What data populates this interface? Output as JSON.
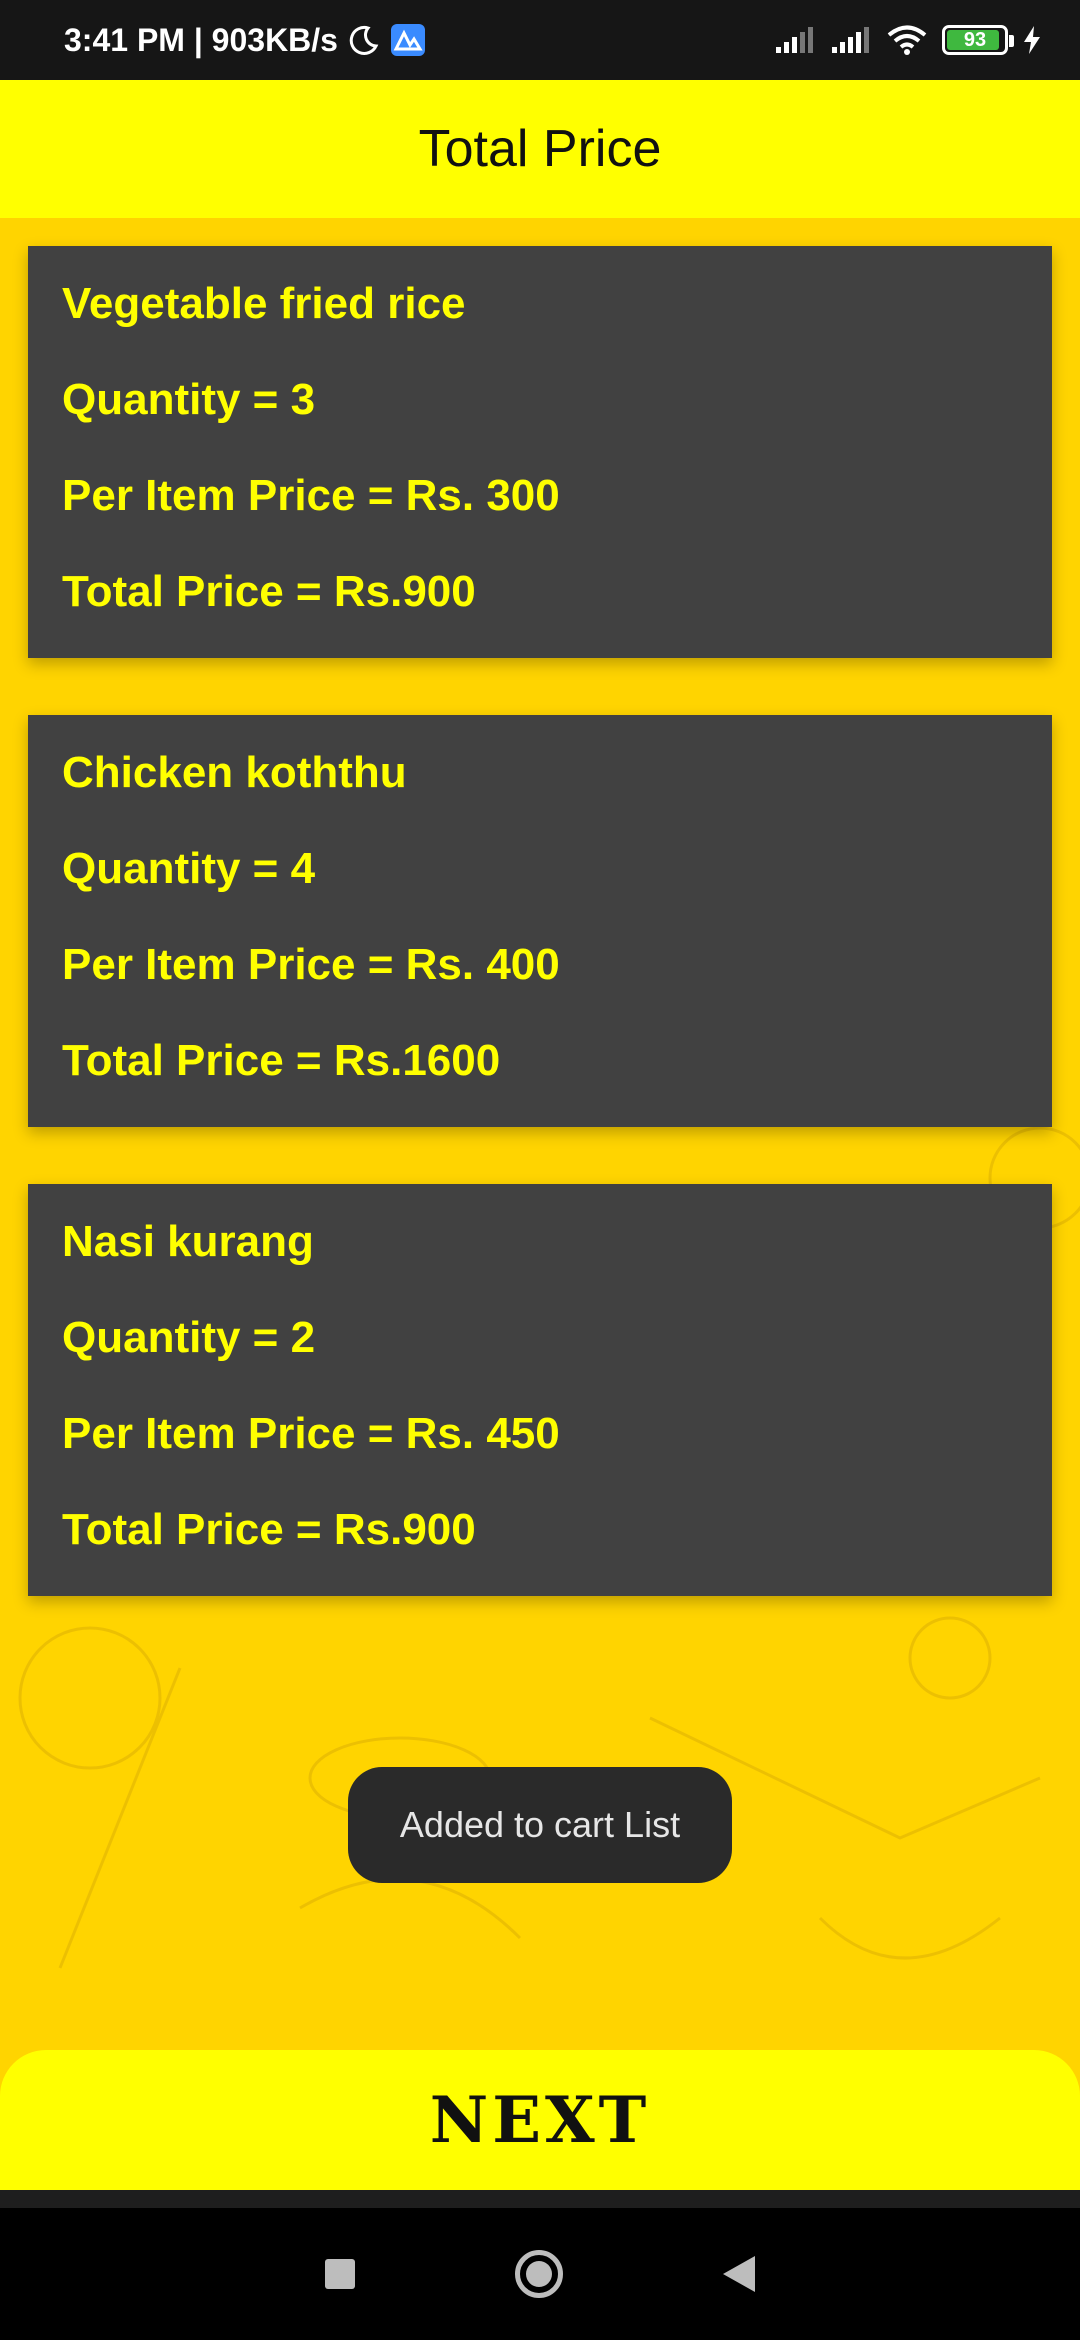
{
  "status_bar": {
    "time_speed": "3:41 PM | 903KB/s",
    "battery": "93",
    "icons": [
      "moon-icon",
      "app-notification-icon",
      "signal-icon",
      "signal-icon",
      "wifi-icon",
      "battery-icon",
      "charging-icon"
    ]
  },
  "header": {
    "title": "Total Price"
  },
  "cart": {
    "items": [
      {
        "name": "Vegetable fried rice",
        "quantity": "Quantity = 3",
        "per_item": "Per Item Price = Rs. 300",
        "total": "Total Price = Rs.900"
      },
      {
        "name": "Chicken koththu",
        "quantity": "Quantity = 4",
        "per_item": "Per Item Price = Rs. 400",
        "total": "Total Price = Rs.1600"
      },
      {
        "name": "Nasi kurang",
        "quantity": "Quantity = 2",
        "per_item": "Per Item Price = Rs. 450",
        "total": "Total Price = Rs.900"
      }
    ]
  },
  "toast": {
    "message": "Added to cart List"
  },
  "next_button": {
    "label": "NEXT"
  },
  "colors": {
    "accent": "#ffff00",
    "card": "#414141",
    "background": "#ffd400"
  }
}
